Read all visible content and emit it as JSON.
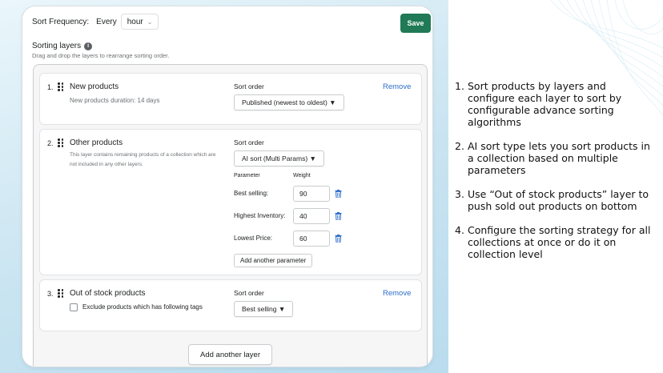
{
  "sort_frequency": {
    "label": "Sort Frequency:",
    "every_label": "Every",
    "unit_value": "hour"
  },
  "save_label": "Save",
  "sorting_layers": {
    "title": "Sorting layers",
    "subtitle": "Drag and drop the layers to rearrange sorting order."
  },
  "layers": [
    {
      "number": "1.",
      "name": "New products",
      "description": "New products duration: 14 days",
      "sort_order_label": "Sort order",
      "sort_order_value": "Published (newest to oldest) ▼",
      "remove_label": "Remove"
    },
    {
      "number": "2.",
      "name": "Other products",
      "description": "This layer contains remaining products of a collection which are not included in any other layers.",
      "sort_order_label": "Sort order",
      "sort_order_value": "AI sort (Multi Params) ▼",
      "parameter_header": "Parameter",
      "weight_header": "Weight",
      "parameters": [
        {
          "label": "Best selling:",
          "weight": "90"
        },
        {
          "label": "Highest Inventory:",
          "weight": "40"
        },
        {
          "label": "Lowest Price:",
          "weight": "60"
        }
      ],
      "add_parameter_label": "Add another parameter"
    },
    {
      "number": "3.",
      "name": "Out of stock products",
      "checkbox_label": "Exclude products which has following tags",
      "sort_order_label": "Sort order",
      "sort_order_value": "Best selling ▼",
      "remove_label": "Remove"
    }
  ],
  "add_layer_label": "Add another layer",
  "notes": [
    {
      "number": "1.",
      "text": "Sort products by layers and configure each layer to sort by configurable advance sorting algorithms"
    },
    {
      "number": "2.",
      "text": "AI sort type lets you sort products in a collection based on multiple parameters"
    },
    {
      "number": "3.",
      "text": "Use “Out of stock products” layer to push sold out products on bottom"
    },
    {
      "number": "4.",
      "text": "Configure the sorting strategy for all collections at once or do it on collection level"
    }
  ],
  "colors": {
    "save_button": "#1f7a55",
    "remove_link": "#2c6ecb",
    "trash_icon": "#2c6ecb"
  }
}
